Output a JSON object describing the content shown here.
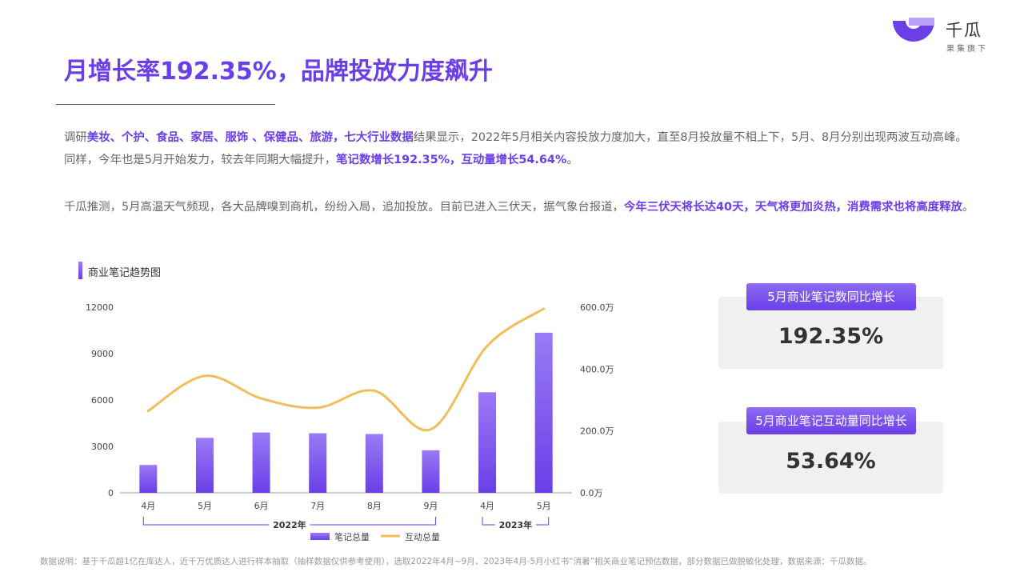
{
  "brand": {
    "name": "千瓜",
    "sub": "果集旗下",
    "color": "#6a3fe8"
  },
  "title": "月增长率192.35%，品牌投放力度飙升",
  "paragraph1": {
    "p1": "调研",
    "h1": "美妆、个护、食品、家居、服饰 、保健品、旅游，七大行业数据",
    "p2": "结果显示，2022年5月相关内容投放力度加大，直至8月投放量不相上下，5月、8月分别出现两波互动高峰。同样，今年也是5月开始发力，较去年同期大幅提升，",
    "h2": "笔记数增长192.35%，互动量增长54.64%",
    "p3": "。"
  },
  "paragraph2": {
    "p1": "千瓜推测，5月高温天气频现，各大品牌嗅到商机，纷纷入局，追加投放。目前已进入三伏天，据气象台报道，",
    "h1": "今年三伏天将长达40天，天气将更加炎热，消费需求也将高度释放",
    "p2": "。"
  },
  "chart_title": "商业笔记趋势图",
  "chart_data": {
    "type": "bar+line",
    "categories": [
      "4月",
      "5月",
      "6月",
      "7月",
      "8月",
      "9月",
      "4月",
      "5月"
    ],
    "groups": [
      {
        "label": "2022年",
        "from": 0,
        "to": 5
      },
      {
        "label": "2023年",
        "from": 6,
        "to": 7
      }
    ],
    "series": [
      {
        "name": "笔记总量",
        "type": "bar",
        "axis": "left",
        "color": "#7b52ef",
        "values": [
          1800,
          3550,
          3900,
          3850,
          3800,
          2750,
          6500,
          10350
        ]
      },
      {
        "name": "互动总量",
        "type": "line",
        "axis": "right",
        "color": "#f2bc5c",
        "values": [
          265,
          378,
          305,
          275,
          330,
          205,
          475,
          595
        ]
      }
    ],
    "y_left": {
      "min": 0,
      "max": 12000,
      "ticks": [
        "0",
        "3000",
        "6000",
        "9000",
        "12000"
      ]
    },
    "y_right": {
      "min": 0,
      "max": 600,
      "ticks": [
        "0.0万",
        "200.0万",
        "400.0万",
        "600.0万"
      ]
    },
    "legend_placement": "bottom",
    "grid": false
  },
  "stats": [
    {
      "label": "5月商业笔记数同比增长",
      "value": "192.35%"
    },
    {
      "label": "5月商业笔记互动量同比增长",
      "value": "53.64%"
    }
  ],
  "footnote": "数据说明：基于千瓜超1亿在库达人，近千万优质达人进行样本抽取（抽样数据仅供参考使用），选取2022年4月~9月、2023年4月-5月小红书“消暑”相关商业笔记预估数据，部分数据已做脱敏化处理，数据来源：千瓜数据。"
}
